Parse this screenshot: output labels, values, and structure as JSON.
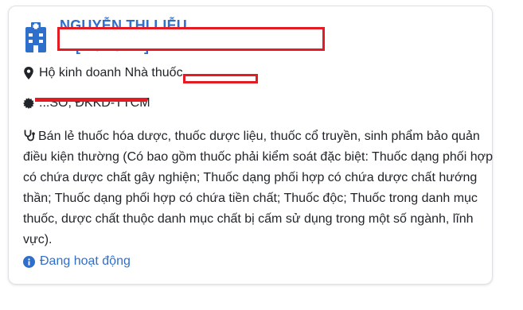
{
  "card": {
    "name": "NGUYỄN THỊ LIỄU",
    "certificate_line": "...   [..../..../20..]",
    "address_label": "Hộ kinh doanh Nhà thuốc",
    "license_text": "...SO, ĐKKD-TTCM",
    "description": "Bán lẻ thuốc hóa dược, thuốc dược liệu, thuốc cổ truyền, sinh phẩm bảo quản điều kiện thường (Có bao gồm thuốc phải kiểm soát đặc biệt: Thuốc dạng phối hợp có chứa dược chất gây nghiện; Thuốc dạng phối hợp có chứa dược chất hướng thần; Thuốc dạng phối hợp có chứa tiền chất; Thuốc độc; Thuốc trong danh mục thuốc, dược chất thuộc danh mục chất bị cấm sử dụng trong một số ngành, lĩnh vực).",
    "status": "Đang hoạt động"
  },
  "icons": {
    "header": "hospital-building-icon",
    "address": "map-marker-icon",
    "license": "certificate-seal-icon",
    "description": "stethoscope-icon",
    "status": "info-circle-icon"
  },
  "colors": {
    "accent": "#2f6fcc",
    "redaction": "#e31b23",
    "border": "#dee2e6",
    "text": "#212529"
  }
}
